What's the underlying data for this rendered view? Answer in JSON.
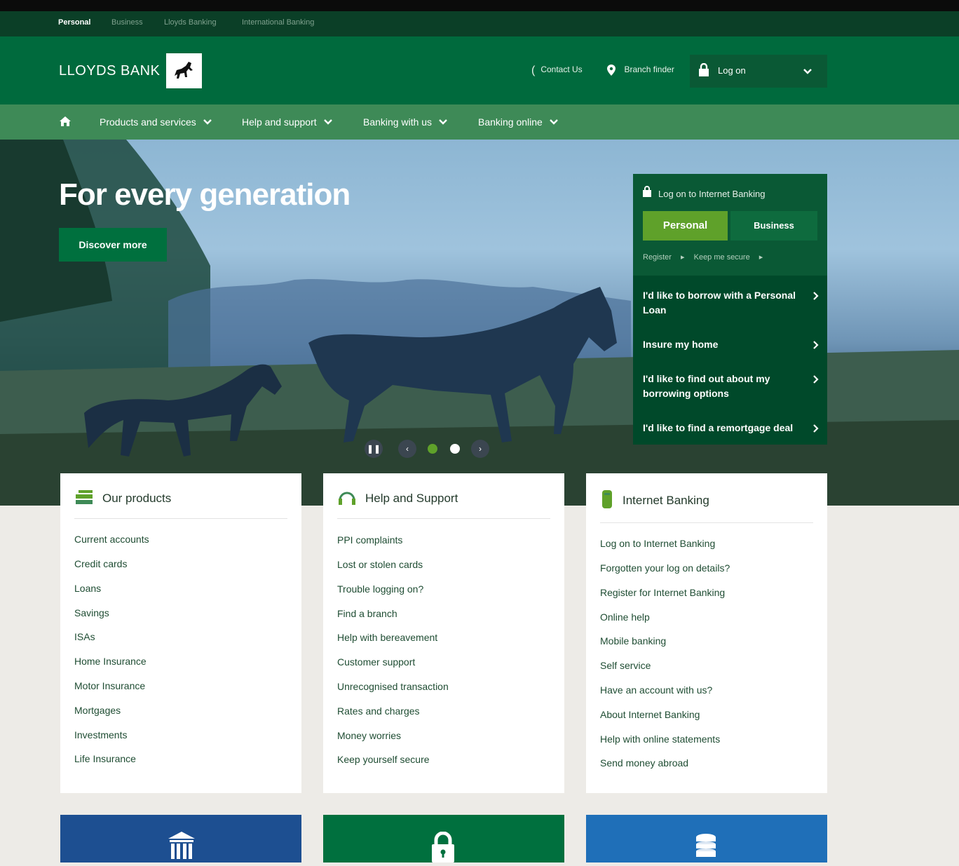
{
  "segments": {
    "items": [
      "Personal",
      "Business",
      "Lloyds Banking",
      "International Banking"
    ],
    "active": "Personal"
  },
  "header": {
    "brand": "LLOYDS BANK",
    "contact": "Contact Us",
    "branch": "Branch finder",
    "logon": "Log on"
  },
  "nav": {
    "products": "Products and services",
    "help": "Help and support",
    "banking_with_us": "Banking with us",
    "banking_online": "Banking online"
  },
  "hero": {
    "title": "For every generation",
    "cta": "Discover more"
  },
  "login_panel": {
    "heading": "Log on to Internet Banking",
    "tab_personal": "Personal",
    "tab_business": "Business",
    "register": "Register",
    "keep_secure": "Keep me secure",
    "quick_links": [
      "I'd like to borrow with a Personal Loan",
      "Insure my home",
      "I'd like to find out about my borrowing options",
      "I'd like to find a remortgage deal"
    ]
  },
  "cards": {
    "products": {
      "title": "Our products",
      "links": [
        "Current accounts",
        "Credit cards",
        "Loans",
        "Savings",
        "ISAs",
        "Home Insurance",
        "Motor Insurance",
        "Mortgages",
        "Investments",
        "Life Insurance"
      ]
    },
    "help": {
      "title": "Help and Support",
      "links": [
        "PPI complaints",
        "Lost or stolen cards",
        "Trouble logging on?",
        "Find a branch",
        "Help with bereavement",
        "Customer support",
        "Unrecognised transaction",
        "Rates and charges",
        "Money worries",
        "Keep yourself secure"
      ]
    },
    "internet": {
      "title": "Internet Banking",
      "links": [
        "Log on to Internet Banking",
        "Forgotten your log on details?",
        "Register for Internet Banking",
        "Online help",
        "Mobile banking",
        "Self service",
        "Have an account with us?",
        "About Internet Banking",
        "Help with online statements",
        "Send money abroad"
      ]
    }
  },
  "colors": {
    "brand_green": "#006a3d",
    "nav_green": "#3e8a57",
    "panel_green": "#0a5935",
    "accent_lime": "#5fa12a",
    "tile_blue": "#1d4f91"
  }
}
